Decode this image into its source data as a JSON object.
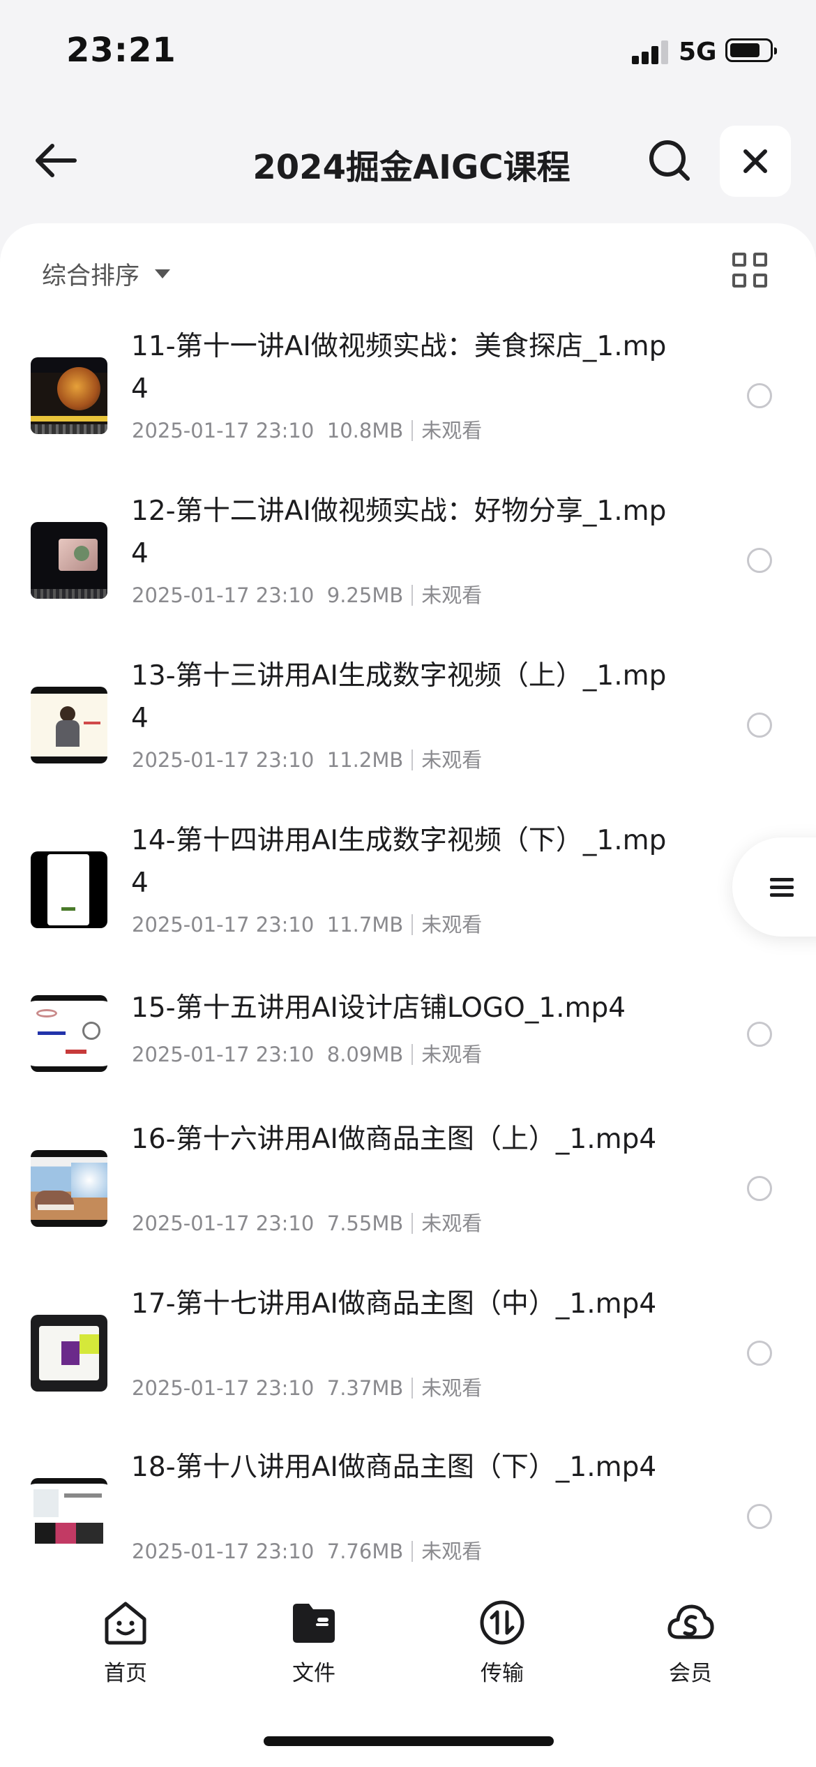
{
  "status_bar": {
    "time": "23:21",
    "network": "5G",
    "signal_bars": 3,
    "battery_level": 0.75
  },
  "header": {
    "title": "2024掘金AIGC课程",
    "icons": {
      "back": "arrow-left-icon",
      "search": "search-icon",
      "close": "close-icon"
    }
  },
  "sort": {
    "label": "综合排序",
    "icons": {
      "caret": "caret-down-icon",
      "view": "grid-view-icon"
    }
  },
  "files": [
    {
      "name": "11-第十一讲AI做视频实战：美食探店_1.mp4",
      "date": "2025-01-17 23:10",
      "size": "10.8MB",
      "status": "未观看"
    },
    {
      "name": "12-第十二讲AI做视频实战：好物分享_1.mp4",
      "date": "2025-01-17 23:10",
      "size": "9.25MB",
      "status": "未观看"
    },
    {
      "name": "13-第十三讲用AI生成数字视频（上）_1.mp4",
      "date": "2025-01-17 23:10",
      "size": "11.2MB",
      "status": "未观看"
    },
    {
      "name": "14-第十四讲用AI生成数字视频（下）_1.mp4",
      "date": "2025-01-17 23:10",
      "size": "11.7MB",
      "status": "未观看"
    },
    {
      "name": "15-第十五讲用AI设计店铺LOGO_1.mp4",
      "date": "2025-01-17 23:10",
      "size": "8.09MB",
      "status": "未观看"
    },
    {
      "name": "16-第十六讲用AI做商品主图（上）_1.mp4",
      "date": "2025-01-17 23:10",
      "size": "7.55MB",
      "status": "未观看"
    },
    {
      "name": "17-第十七讲用AI做商品主图（中）_1.mp4",
      "date": "2025-01-17 23:10",
      "size": "7.37MB",
      "status": "未观看"
    },
    {
      "name": "18-第十八讲用AI做商品主图（下）_1.mp4",
      "date": "2025-01-17 23:10",
      "size": "7.76MB",
      "status": "未观看"
    }
  ],
  "floating_menu": {
    "icon": "menu-icon"
  },
  "tabbar": {
    "tabs": [
      {
        "label": "首页",
        "icon": "home-smile-icon"
      },
      {
        "label": "文件",
        "icon": "folder-icon"
      },
      {
        "label": "传输",
        "icon": "transfer-icon"
      },
      {
        "label": "会员",
        "icon": "cloud-member-icon"
      }
    ],
    "active_tab": "文件"
  }
}
